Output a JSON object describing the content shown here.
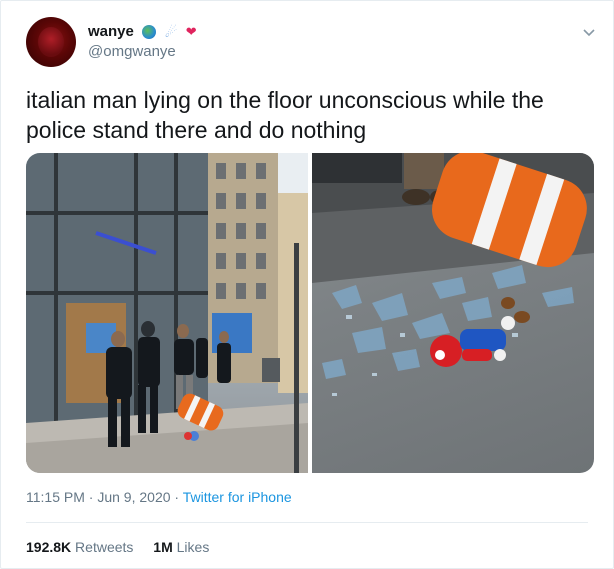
{
  "author": {
    "display_name": "wanye",
    "handle": "@omgwanye",
    "name_emojis": [
      "globe-emoji",
      "comet-emoji",
      "heart-emoji"
    ]
  },
  "tweet": {
    "text": "italian man lying on the floor unconscious while the police stand there and do nothing",
    "time": "11:15 PM",
    "separator": "·",
    "date": "Jun 9, 2020",
    "source": "Twitter for iPhone"
  },
  "stats": {
    "retweets_count": "192.8K",
    "retweets_label": "Retweets",
    "likes_count": "1M",
    "likes_label": "Likes"
  },
  "colors": {
    "link": "#1b95e0",
    "secondary_text": "#657786",
    "primary_text": "#14171a"
  }
}
